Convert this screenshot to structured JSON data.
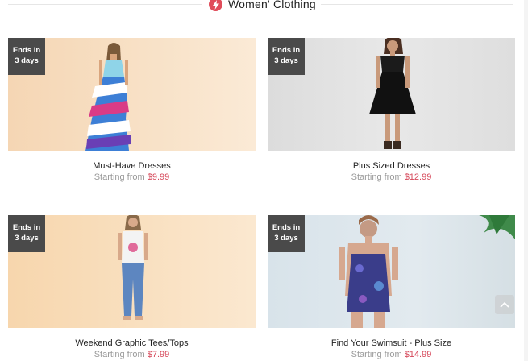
{
  "section": {
    "title": "Women' Clothing",
    "icon": "lightning-icon",
    "accent": "#e04c5a"
  },
  "cards": [
    {
      "title": "Must-Have Dresses",
      "price_prefix": "Starting from ",
      "price": "$9.99",
      "badge_line1": "Ends in",
      "badge_line2": "3 days",
      "bg": "#f6dcc0"
    },
    {
      "title": "Plus Sized Dresses",
      "price_prefix": "Starting from ",
      "price": "$12.99",
      "badge_line1": "Ends in",
      "badge_line2": "3 days",
      "bg": "#e3e3e3"
    },
    {
      "title": "Weekend Graphic Tees/Tops",
      "price_prefix": "Starting from ",
      "price": "$7.99",
      "badge_line1": "Ends in",
      "badge_line2": "3 days",
      "bg": "#f7d9b6"
    },
    {
      "title": "Find Your Swimsuit - Plus Size",
      "price_prefix": "Starting from ",
      "price": "$14.99",
      "badge_line1": "Ends in",
      "badge_line2": "3 days",
      "bg": "#dce6ec"
    }
  ],
  "back_to_top_icon": "chevron-up-icon",
  "price_color": "#d6485a"
}
